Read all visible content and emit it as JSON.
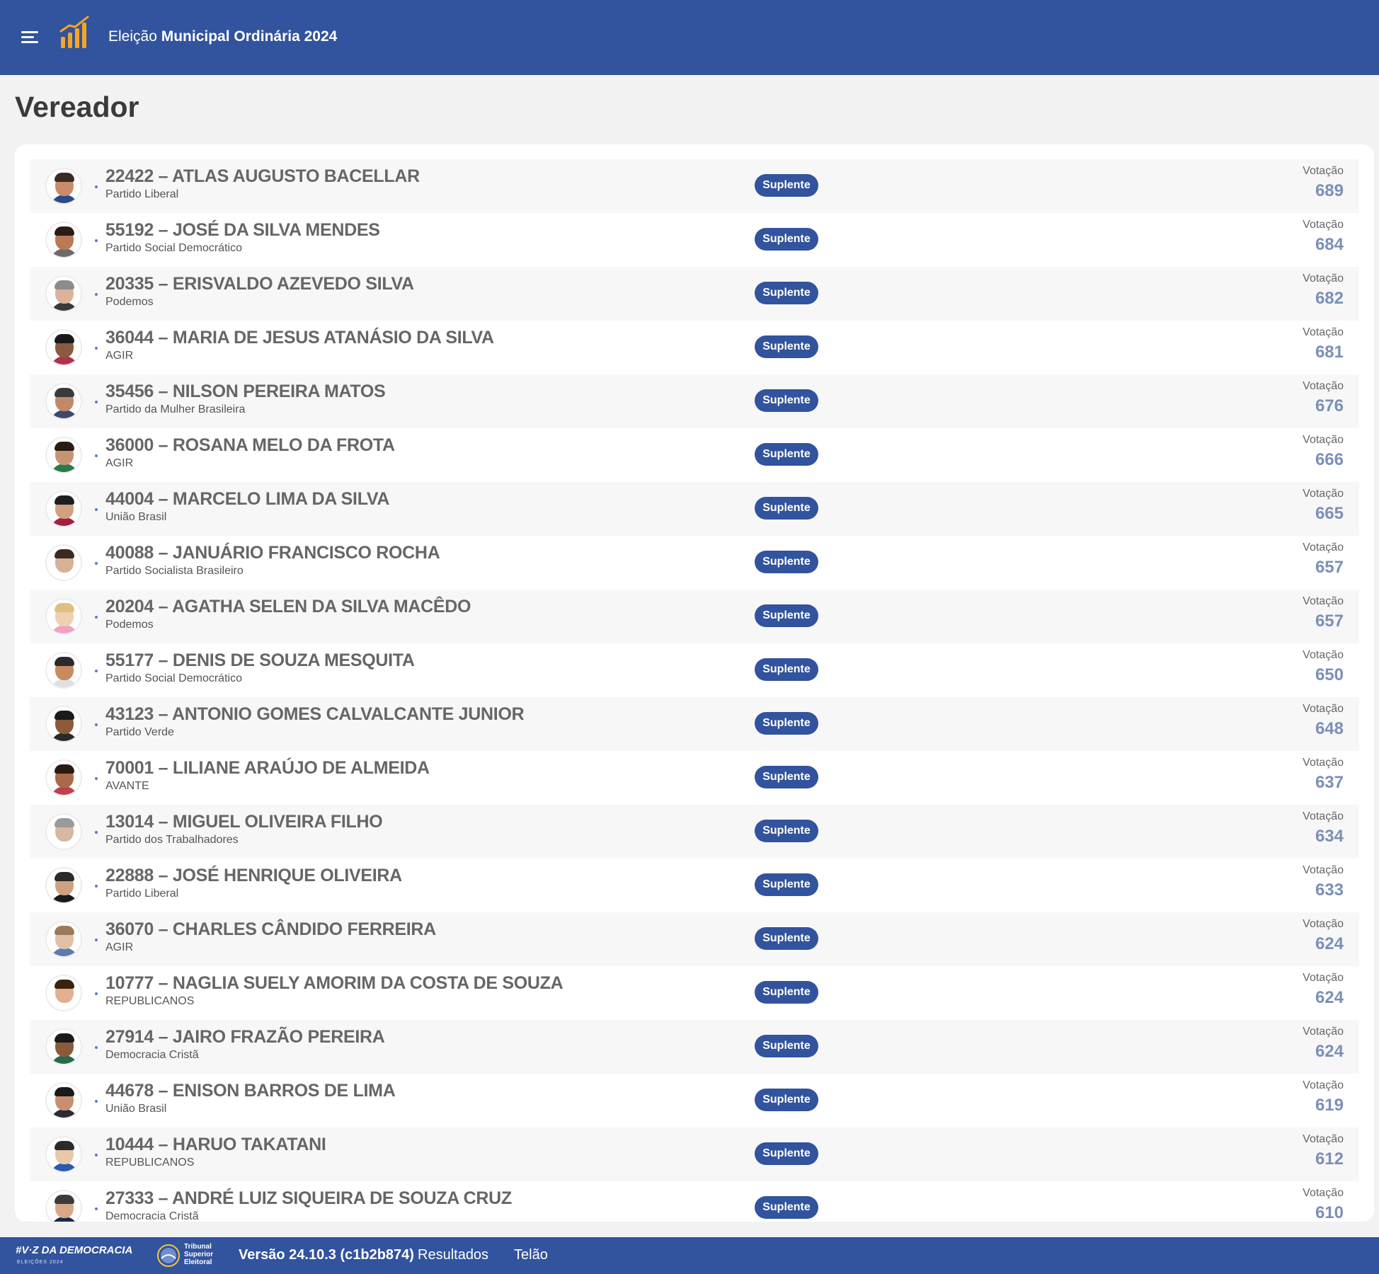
{
  "header": {
    "title_prefix": "Eleição",
    "title_main": "Municipal Ordinária 2024"
  },
  "page": {
    "title": "Vereador"
  },
  "labels": {
    "vote": "Votação",
    "status": "Suplente"
  },
  "colors": {
    "primary": "#32539d",
    "vote_value": "#7b8fb8",
    "background": "#f2f2f2"
  },
  "candidates": [
    {
      "name": "22422 – ATLAS AUGUSTO BACELLAR",
      "party": "Partido Liberal",
      "status": "Suplente",
      "votes": "689"
    },
    {
      "name": "55192 – JOSÉ DA SILVA MENDES",
      "party": "Partido Social Democrático",
      "status": "Suplente",
      "votes": "684"
    },
    {
      "name": "20335 – ERISVALDO AZEVEDO SILVA",
      "party": "Podemos",
      "status": "Suplente",
      "votes": "682"
    },
    {
      "name": "36044 – MARIA DE JESUS ATANÁSIO DA SILVA",
      "party": "AGIR",
      "status": "Suplente",
      "votes": "681"
    },
    {
      "name": "35456 – NILSON PEREIRA MATOS",
      "party": "Partido da Mulher Brasileira",
      "status": "Suplente",
      "votes": "676"
    },
    {
      "name": "36000 – ROSANA MELO DA FROTA",
      "party": "AGIR",
      "status": "Suplente",
      "votes": "666"
    },
    {
      "name": "44004 – MARCELO LIMA DA SILVA",
      "party": "União Brasil",
      "status": "Suplente",
      "votes": "665"
    },
    {
      "name": "40088 – JANUÁRIO FRANCISCO ROCHA",
      "party": "Partido Socialista Brasileiro",
      "status": "Suplente",
      "votes": "657"
    },
    {
      "name": "20204 – AGATHA SELEN DA SILVA MACÊDO",
      "party": "Podemos",
      "status": "Suplente",
      "votes": "657"
    },
    {
      "name": "55177 – DENIS DE SOUZA MESQUITA",
      "party": "Partido Social Democrático",
      "status": "Suplente",
      "votes": "650"
    },
    {
      "name": "43123 – ANTONIO GOMES CALVALCANTE JUNIOR",
      "party": "Partido Verde",
      "status": "Suplente",
      "votes": "648"
    },
    {
      "name": "70001 – LILIANE ARAÚJO DE ALMEIDA",
      "party": "AVANTE",
      "status": "Suplente",
      "votes": "637"
    },
    {
      "name": "13014 – MIGUEL OLIVEIRA FILHO",
      "party": "Partido dos Trabalhadores",
      "status": "Suplente",
      "votes": "634"
    },
    {
      "name": "22888 – JOSÉ HENRIQUE OLIVEIRA",
      "party": "Partido Liberal",
      "status": "Suplente",
      "votes": "633"
    },
    {
      "name": "36070 – CHARLES CÂNDIDO FERREIRA",
      "party": "AGIR",
      "status": "Suplente",
      "votes": "624"
    },
    {
      "name": "10777 – NAGLIA SUELY AMORIM DA COSTA DE SOUZA",
      "party": "REPUBLICANOS",
      "status": "Suplente",
      "votes": "624"
    },
    {
      "name": "27914 – JAIRO FRAZÃO PEREIRA",
      "party": "Democracia Cristã",
      "status": "Suplente",
      "votes": "624"
    },
    {
      "name": "44678 – ENISON BARROS DE LIMA",
      "party": "União Brasil",
      "status": "Suplente",
      "votes": "619"
    },
    {
      "name": "10444 – HARUO TAKATANI",
      "party": "REPUBLICANOS",
      "status": "Suplente",
      "votes": "612"
    },
    {
      "name": "27333 – ANDRÉ LUIZ SIQUEIRA DE SOUZA CRUZ",
      "party": "Democracia Cristã",
      "status": "Suplente",
      "votes": "610"
    }
  ],
  "footer": {
    "campaign_logo": "#V·Z DA DEMOCRACIA",
    "campaign_sub": "ELEIÇÕES 2024",
    "tse_line1": "Tribunal",
    "tse_line2": "Superior",
    "tse_line3": "Eleitoral",
    "version": "Versão 24.10.3 (c1b2b874)",
    "link_results": "Resultados",
    "link_screen": "Telão"
  }
}
